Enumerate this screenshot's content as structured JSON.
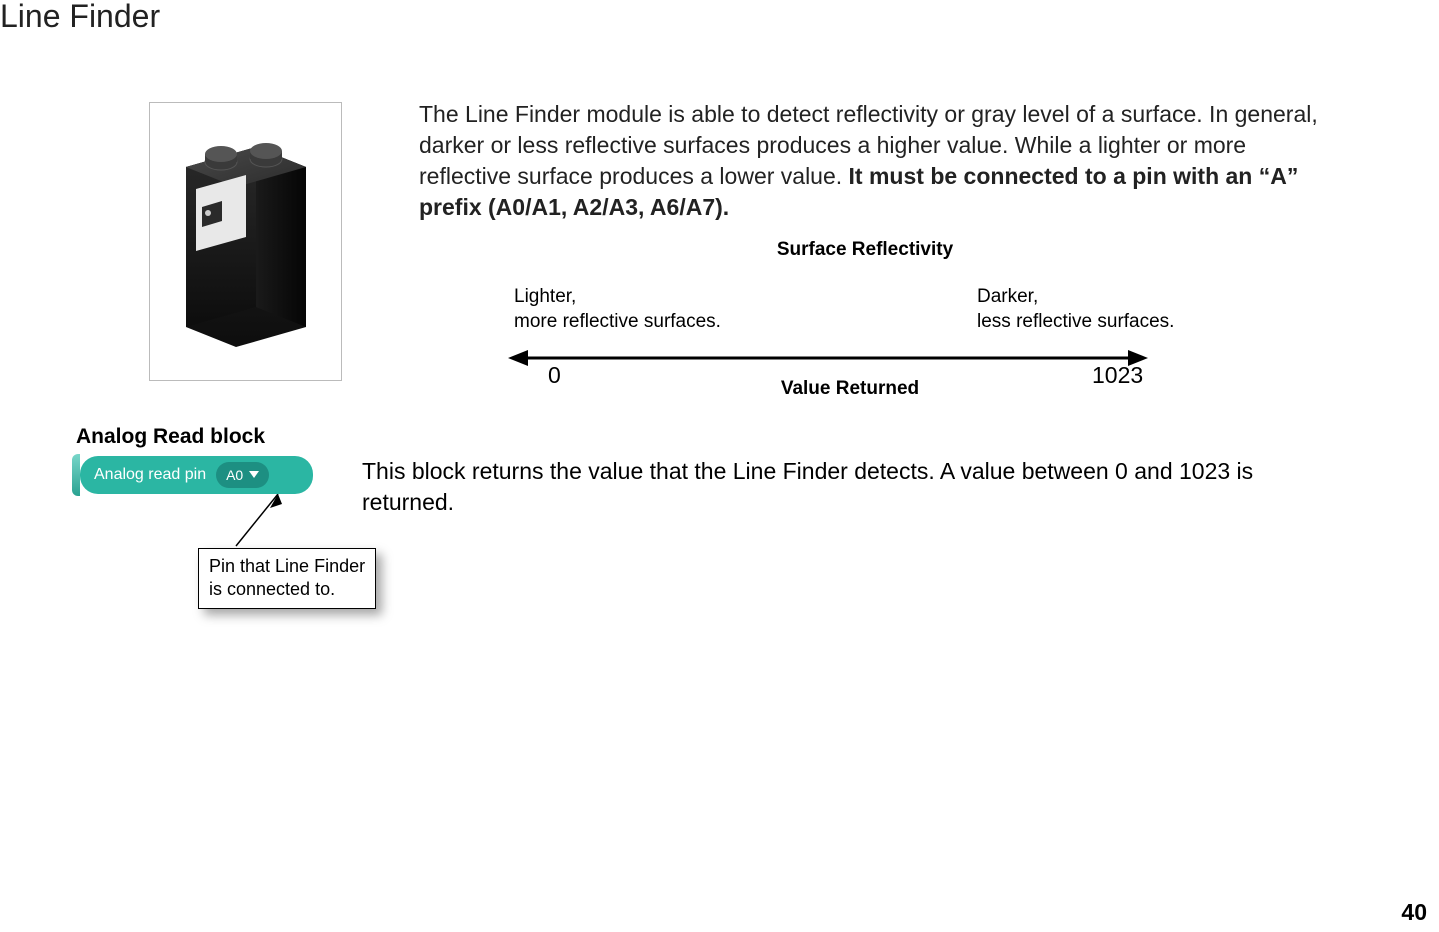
{
  "title": "Line Finder",
  "intro": {
    "part1": "The Line Finder module is able to detect reflectivity or gray level of a surface. In general, darker or less reflective surfaces produces a higher value. While a lighter or more reflective surface produces a lower value. ",
    "bold": "It must be connected to a pin with an “A” prefix (A0/A1, A2/A3, A6/A7)."
  },
  "diagram": {
    "title": "Surface Reflectivity",
    "lighter_l1": "Lighter,",
    "lighter_l2": "more reflective surfaces.",
    "darker_l1": "Darker,",
    "darker_l2": "less reflective surfaces.",
    "min": "0",
    "max": "1023",
    "value_label": "Value Returned"
  },
  "section_heading": "Analog Read block",
  "block": {
    "label": "Analog read pin",
    "pin": "A0"
  },
  "block_description": "This block returns the value that the Line Finder detects. A value between 0 and 1023 is returned.",
  "callout": {
    "l1": "Pin that Line Finder",
    "l2": "is connected to."
  },
  "page_number": "40"
}
